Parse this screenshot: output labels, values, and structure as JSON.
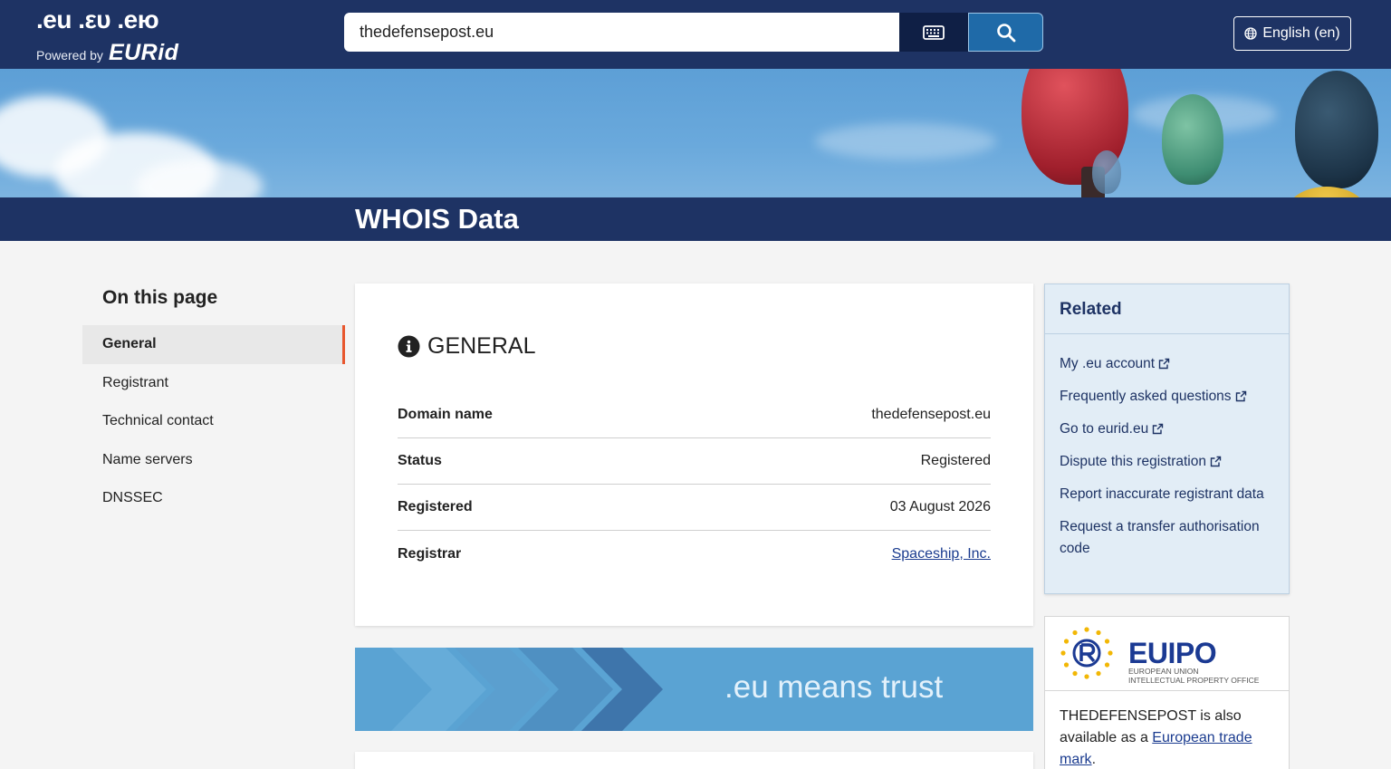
{
  "header": {
    "logo_exts": ".eu .ευ .ею",
    "logo_powered_by": "Powered by",
    "logo_brand": "EURid",
    "search_value": "thedefensepost.eu",
    "language_label": "English (en)"
  },
  "page": {
    "title": "WHOIS Data"
  },
  "sidebar": {
    "heading": "On this page",
    "items": [
      {
        "label": "General",
        "active": true
      },
      {
        "label": "Registrant"
      },
      {
        "label": "Technical contact"
      },
      {
        "label": "Name servers"
      },
      {
        "label": "DNSSEC"
      }
    ]
  },
  "general": {
    "heading": "GENERAL",
    "rows": [
      {
        "label": "Domain name",
        "value": "thedefensepost.eu"
      },
      {
        "label": "Status",
        "value": "Registered"
      },
      {
        "label": "Registered",
        "value": "03 August 2026"
      },
      {
        "label": "Registrar",
        "value": "Spaceship, Inc."
      }
    ]
  },
  "banner": {
    "text": ".eu means trust"
  },
  "related": {
    "heading": "Related",
    "links": [
      {
        "label": "My .eu account",
        "external": true
      },
      {
        "label": "Frequently asked questions",
        "external": true
      },
      {
        "label": "Go to eurid.eu",
        "external": true
      },
      {
        "label": "Dispute this registration",
        "external": true
      },
      {
        "label": "Report inaccurate registrant data",
        "external": false
      },
      {
        "label": "Request a transfer authorisation code",
        "external": false
      }
    ]
  },
  "euipo": {
    "logo_word": "EUIPO",
    "logo_sub_1": "EUROPEAN UNION",
    "logo_sub_2": "INTELLECTUAL PROPERTY OFFICE",
    "text_before": "THEDEFENSEPOST is also available as a ",
    "link_text": "European trade mark",
    "text_after": "."
  },
  "colors": {
    "header_bg": "#1e3364",
    "search_button": "#1f6aa8",
    "active_nav_accent": "#e8572e",
    "related_bg": "#e2edf6",
    "banner_bg": "#5aa3d3"
  },
  "icons": [
    "keyboard-icon",
    "search-icon",
    "globe-icon",
    "info-icon",
    "external-link-icon"
  ]
}
